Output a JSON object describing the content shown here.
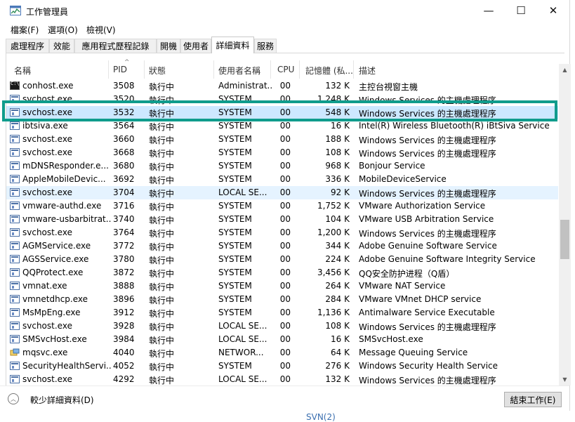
{
  "window": {
    "title": "工作管理員",
    "minimize_glyph": "—",
    "maximize_glyph": "☐",
    "close_glyph": "✕"
  },
  "menu": [
    "檔案(F)",
    "選項(O)",
    "檢視(V)"
  ],
  "tabs": [
    {
      "label": "處理程序"
    },
    {
      "label": "效能"
    },
    {
      "label": "應用程式歷程記錄"
    },
    {
      "label": "開機"
    },
    {
      "label": "使用者"
    },
    {
      "label": "詳細資料",
      "active": true
    },
    {
      "label": "服務"
    }
  ],
  "columns": {
    "name": "名稱",
    "pid": "PID",
    "status": "狀態",
    "user": "使用者名稱",
    "cpu": "CPU",
    "memory": "記憶體 (私...",
    "description": "描述"
  },
  "rows": [
    {
      "icon": "console-icon",
      "name": "conhost.exe",
      "pid": "3508",
      "status": "執行中",
      "user": "Administrat...",
      "cpu": "00",
      "mem": "132 K",
      "desc": "主控台視窗主機"
    },
    {
      "icon": "service-icon",
      "name": "svchost.exe",
      "pid": "3520",
      "status": "執行中",
      "user": "SYSTEM",
      "cpu": "00",
      "mem": "1,248 K",
      "desc": "Windows Services 的主機處理程序"
    },
    {
      "icon": "service-icon",
      "name": "svchost.exe",
      "pid": "3532",
      "status": "執行中",
      "user": "SYSTEM",
      "cpu": "00",
      "mem": "548 K",
      "desc": "Windows Services 的主機處理程序",
      "selected": true
    },
    {
      "icon": "service-icon",
      "name": "ibtsiva.exe",
      "pid": "3564",
      "status": "執行中",
      "user": "SYSTEM",
      "cpu": "00",
      "mem": "16 K",
      "desc": "Intel(R) Wireless Bluetooth(R) iBtSiva Service"
    },
    {
      "icon": "service-icon",
      "name": "svchost.exe",
      "pid": "3660",
      "status": "執行中",
      "user": "SYSTEM",
      "cpu": "00",
      "mem": "188 K",
      "desc": "Windows Services 的主機處理程序"
    },
    {
      "icon": "service-icon",
      "name": "svchost.exe",
      "pid": "3668",
      "status": "執行中",
      "user": "SYSTEM",
      "cpu": "00",
      "mem": "108 K",
      "desc": "Windows Services 的主機處理程序"
    },
    {
      "icon": "service-icon",
      "name": "mDNSResponder.e...",
      "pid": "3680",
      "status": "執行中",
      "user": "SYSTEM",
      "cpu": "00",
      "mem": "968 K",
      "desc": "Bonjour Service"
    },
    {
      "icon": "service-icon",
      "name": "AppleMobileDevic...",
      "pid": "3692",
      "status": "執行中",
      "user": "SYSTEM",
      "cpu": "00",
      "mem": "336 K",
      "desc": "MobileDeviceService"
    },
    {
      "icon": "service-icon",
      "name": "svchost.exe",
      "pid": "3704",
      "status": "執行中",
      "user": "LOCAL SE...",
      "cpu": "00",
      "mem": "92 K",
      "desc": "Windows Services 的主機處理程序",
      "hover": true
    },
    {
      "icon": "service-icon",
      "name": "vmware-authd.exe",
      "pid": "3716",
      "status": "執行中",
      "user": "SYSTEM",
      "cpu": "00",
      "mem": "1,752 K",
      "desc": "VMware Authorization Service"
    },
    {
      "icon": "service-icon",
      "name": "vmware-usbarbitrat...",
      "pid": "3740",
      "status": "執行中",
      "user": "SYSTEM",
      "cpu": "00",
      "mem": "104 K",
      "desc": "VMware USB Arbitration Service"
    },
    {
      "icon": "service-icon",
      "name": "svchost.exe",
      "pid": "3764",
      "status": "執行中",
      "user": "SYSTEM",
      "cpu": "00",
      "mem": "1,200 K",
      "desc": "Windows Services 的主機處理程序"
    },
    {
      "icon": "service-icon",
      "name": "AGMService.exe",
      "pid": "3772",
      "status": "執行中",
      "user": "SYSTEM",
      "cpu": "00",
      "mem": "344 K",
      "desc": "Adobe Genuine Software Service"
    },
    {
      "icon": "service-icon",
      "name": "AGSService.exe",
      "pid": "3780",
      "status": "執行中",
      "user": "SYSTEM",
      "cpu": "00",
      "mem": "224 K",
      "desc": "Adobe Genuine Software Integrity Service"
    },
    {
      "icon": "service-icon",
      "name": "QQProtect.exe",
      "pid": "3872",
      "status": "執行中",
      "user": "SYSTEM",
      "cpu": "00",
      "mem": "3,456 K",
      "desc": "QQ安全防护进程（Q盾）"
    },
    {
      "icon": "service-icon",
      "name": "vmnat.exe",
      "pid": "3888",
      "status": "執行中",
      "user": "SYSTEM",
      "cpu": "00",
      "mem": "264 K",
      "desc": "VMware NAT Service"
    },
    {
      "icon": "service-icon",
      "name": "vmnetdhcp.exe",
      "pid": "3896",
      "status": "執行中",
      "user": "SYSTEM",
      "cpu": "00",
      "mem": "284 K",
      "desc": "VMware VMnet DHCP service"
    },
    {
      "icon": "service-icon",
      "name": "MsMpEng.exe",
      "pid": "3912",
      "status": "執行中",
      "user": "SYSTEM",
      "cpu": "00",
      "mem": "1,136 K",
      "desc": "Antimalware Service Executable"
    },
    {
      "icon": "service-icon",
      "name": "svchost.exe",
      "pid": "3928",
      "status": "執行中",
      "user": "LOCAL SE...",
      "cpu": "00",
      "mem": "108 K",
      "desc": "Windows Services 的主機處理程序"
    },
    {
      "icon": "service-icon",
      "name": "SMSvcHost.exe",
      "pid": "3984",
      "status": "執行中",
      "user": "LOCAL SE...",
      "cpu": "00",
      "mem": "16 K",
      "desc": "SMSvcHost.exe"
    },
    {
      "icon": "message-queue-icon",
      "name": "mqsvc.exe",
      "pid": "4040",
      "status": "執行中",
      "user": "NETWOR...",
      "cpu": "00",
      "mem": "64 K",
      "desc": "Message Queuing Service"
    },
    {
      "icon": "service-icon",
      "name": "SecurityHealthServi...",
      "pid": "4052",
      "status": "執行中",
      "user": "SYSTEM",
      "cpu": "00",
      "mem": "276 K",
      "desc": "Windows Security Health Service"
    },
    {
      "icon": "service-icon",
      "name": "svchost.exe",
      "pid": "4292",
      "status": "執行中",
      "user": "LOCAL SE...",
      "cpu": "00",
      "mem": "132 K",
      "desc": "Windows Services 的主機處理程序"
    }
  ],
  "footer": {
    "less_details_label": "較少詳細資料(D)",
    "end_task_label": "結束工作(E)"
  },
  "background_text": "SVN(2)",
  "colors": {
    "selected_row": "#cce8ff",
    "hover_row": "#e5f3ff",
    "highlight_box": "#0f9c8c"
  }
}
